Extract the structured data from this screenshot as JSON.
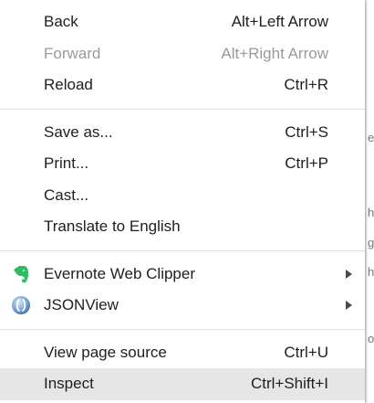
{
  "context_menu": {
    "groups": [
      [
        {
          "label": "Back",
          "shortcut": "Alt+Left Arrow",
          "disabled": false
        },
        {
          "label": "Forward",
          "shortcut": "Alt+Right Arrow",
          "disabled": true
        },
        {
          "label": "Reload",
          "shortcut": "Ctrl+R",
          "disabled": false
        }
      ],
      [
        {
          "label": "Save as...",
          "shortcut": "Ctrl+S"
        },
        {
          "label": "Print...",
          "shortcut": "Ctrl+P"
        },
        {
          "label": "Cast..."
        },
        {
          "label": "Translate to English"
        }
      ],
      [
        {
          "label": "Evernote Web Clipper",
          "icon": "evernote-elephant-icon",
          "has_submenu": true
        },
        {
          "label": "JSONView",
          "icon": "jsonview-icon",
          "has_submenu": true
        }
      ],
      [
        {
          "label": "View page source",
          "shortcut": "Ctrl+U"
        },
        {
          "label": "Inspect",
          "shortcut": "Ctrl+Shift+I",
          "highlighted": true
        }
      ]
    ]
  },
  "background_page": {
    "edge_chars": [
      "e",
      "h",
      "g",
      "h",
      "o"
    ]
  },
  "colors": {
    "menu_text": "#202020",
    "disabled_text": "#9a9a9a",
    "highlight": "#e6e6e6",
    "evernote_green": "#2dbe60"
  }
}
